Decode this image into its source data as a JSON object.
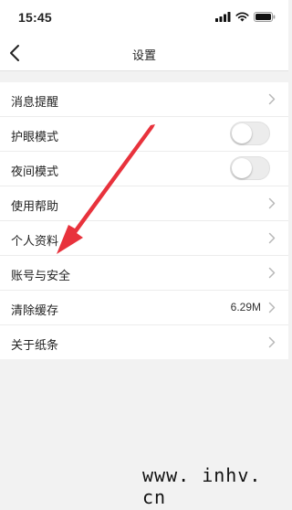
{
  "status_bar": {
    "time": "15:45"
  },
  "nav": {
    "title": "设置"
  },
  "settings": {
    "items": [
      {
        "label": "消息提醒",
        "type": "link"
      },
      {
        "label": "护眼模式",
        "type": "toggle",
        "enabled": false
      },
      {
        "label": "夜间模式",
        "type": "toggle",
        "enabled": false
      },
      {
        "label": "使用帮助",
        "type": "link"
      },
      {
        "label": "个人资料",
        "type": "link"
      },
      {
        "label": "账号与安全",
        "type": "link"
      },
      {
        "label": "清除缓存",
        "type": "link",
        "value": "6.29M"
      },
      {
        "label": "关于纸条",
        "type": "link"
      }
    ]
  },
  "watermark": {
    "text": "www. inhv. cn"
  },
  "colors": {
    "annotation_arrow": "#e8323c",
    "background": "#f2f2f2",
    "toggle_off": "#ececec"
  },
  "icons": {
    "back": "chevron-left-icon",
    "row_arrow": "chevron-right-icon",
    "signal": "cellular-signal-icon",
    "wifi": "wifi-icon",
    "battery": "battery-icon"
  }
}
